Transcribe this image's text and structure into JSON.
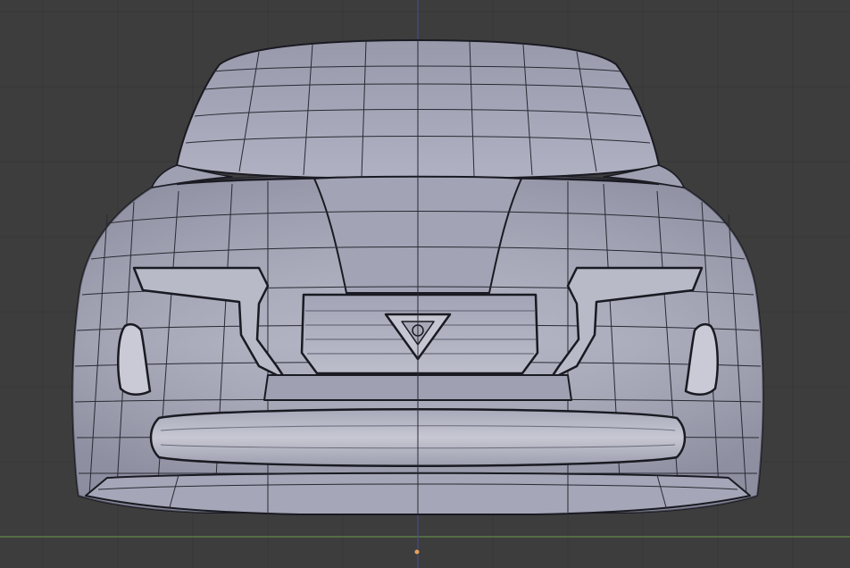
{
  "viewport": {
    "view": "front-orthographic",
    "background_color": "#3d3d3d",
    "grid_color": "#363636",
    "grid_visible": true,
    "x_axis_color": "#6a9a4a",
    "z_axis_color": "#4a4a9a",
    "origin_marker_color": "#e8a060"
  },
  "model": {
    "name": "car-front-body",
    "mode": "edit-mode",
    "wireframe_overlay": true,
    "body_color": "#a8a9b8",
    "edge_color": "#1a1a22",
    "emblem_icon": "triangle-emblem-icon"
  }
}
